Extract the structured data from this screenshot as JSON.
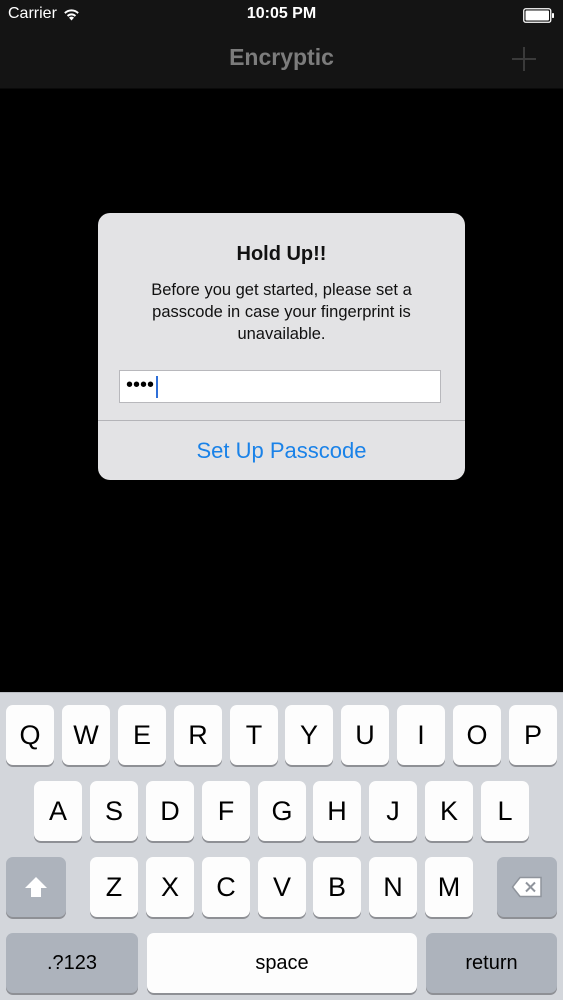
{
  "status_bar": {
    "carrier": "Carrier",
    "time": "10:05 PM",
    "wifi_icon": "wifi-icon",
    "battery_icon": "battery-icon"
  },
  "nav_bar": {
    "title": "Encryptic",
    "add_icon": "plus-icon"
  },
  "alert": {
    "title": "Hold Up!!",
    "message": "Before you get started, please set a passcode in case your fingerprint is unavailable.",
    "passcode_value": "••••",
    "button_label": "Set Up Passcode",
    "button_color": "#1a82e8"
  },
  "keyboard": {
    "row1": [
      "Q",
      "W",
      "E",
      "R",
      "T",
      "Y",
      "U",
      "I",
      "O",
      "P"
    ],
    "row2": [
      "A",
      "S",
      "D",
      "F",
      "G",
      "H",
      "J",
      "K",
      "L"
    ],
    "row3": [
      "Z",
      "X",
      "C",
      "V",
      "B",
      "N",
      "M"
    ],
    "shift_icon": "shift-icon",
    "backspace_icon": "backspace-icon",
    "numbers_label": ".?123",
    "space_label": "space",
    "return_label": "return"
  }
}
